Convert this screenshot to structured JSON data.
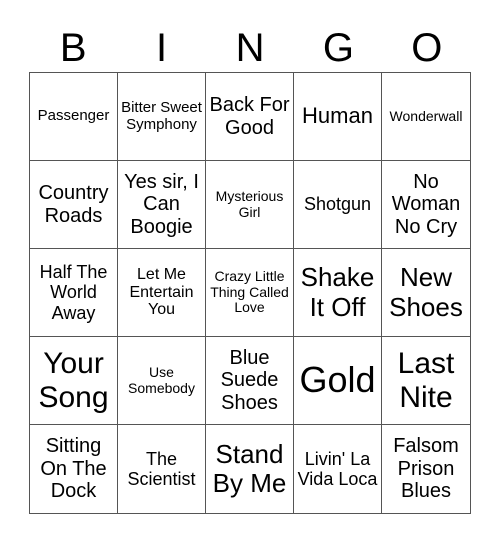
{
  "header": {
    "letters": [
      "B",
      "I",
      "N",
      "G",
      "O"
    ]
  },
  "cells": [
    "Passenger",
    "Bitter Sweet Symphony",
    "Back For Good",
    "Human",
    "Wonderwall",
    "Country Roads",
    "Yes sir, I Can Boogie",
    "Mysterious Girl",
    "Shotgun",
    "No Woman No Cry",
    "Half The World Away",
    "Let Me Entertain You",
    "Crazy Little Thing Called Love",
    "Shake It Off",
    "New Shoes",
    "Your Song",
    "Use Somebody",
    "Blue Suede Shoes",
    "Gold",
    "Last Nite",
    "Sitting On The Dock",
    "The Scientist",
    "Stand By Me",
    "Livin' La Vida Loca",
    "Falsom Prison Blues"
  ]
}
